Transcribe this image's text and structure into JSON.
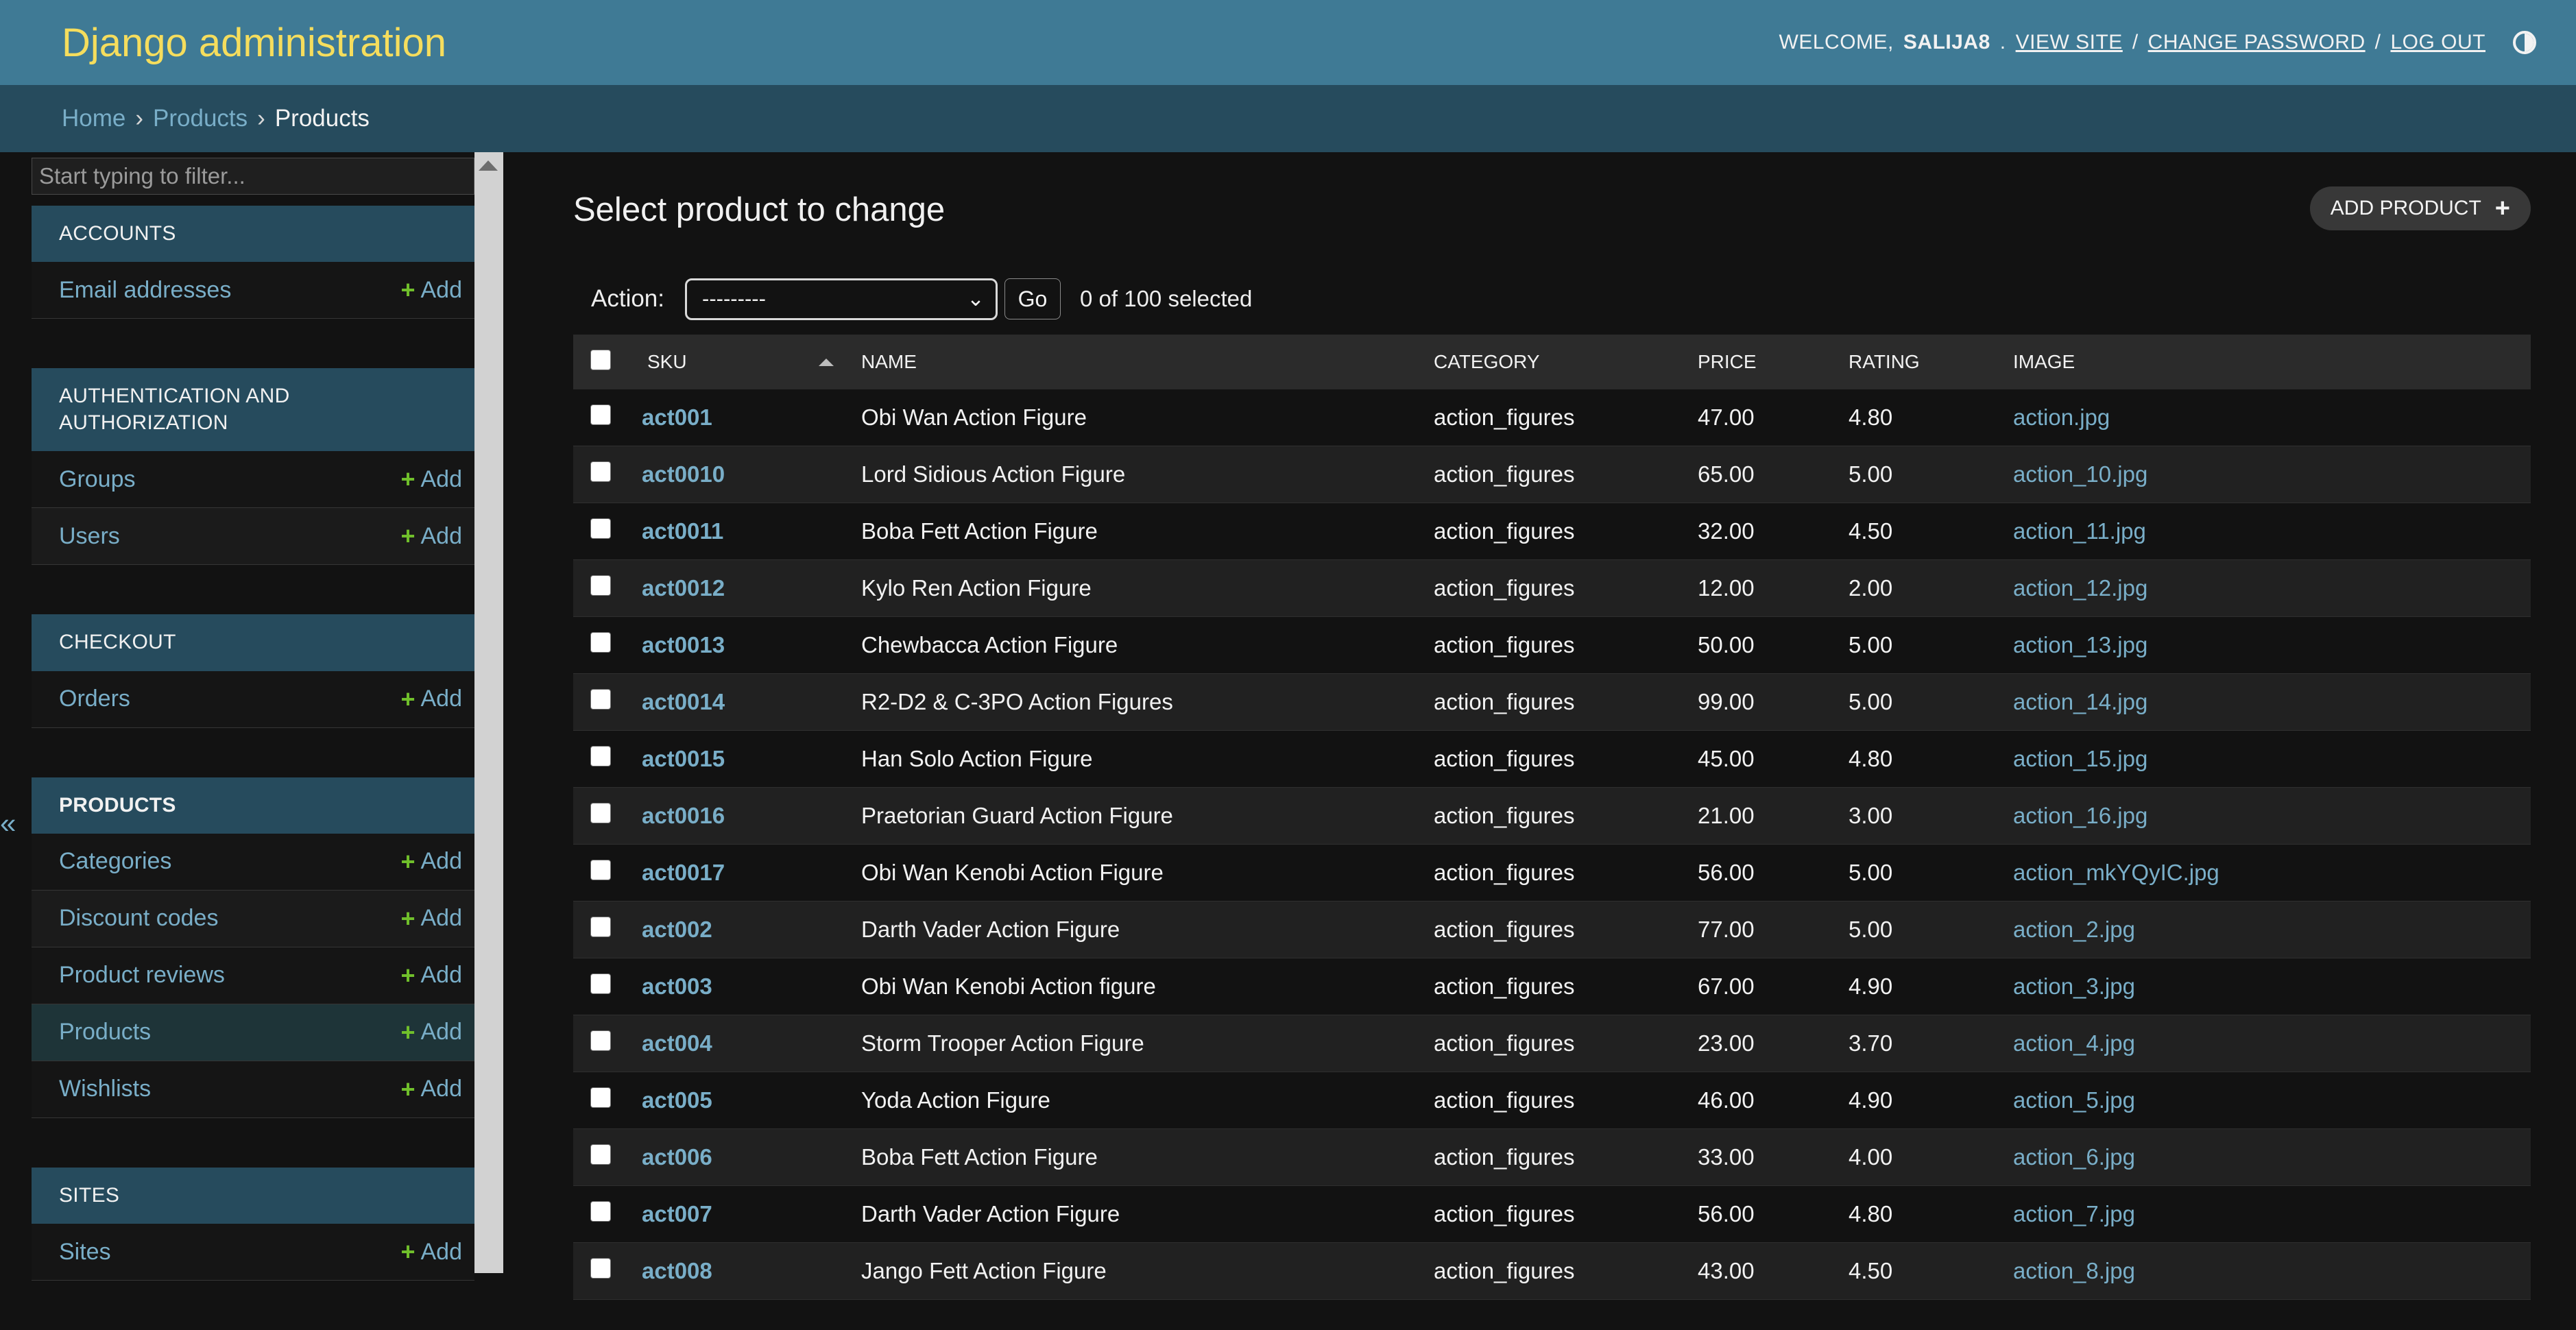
{
  "header": {
    "title": "Django administration",
    "welcome": "WELCOME,",
    "username": "SALIJA8",
    "view_site": "VIEW SITE",
    "change_password": "CHANGE PASSWORD",
    "log_out": "LOG OUT",
    "slash": "/",
    "theme_icon": "theme-toggle-icon"
  },
  "breadcrumbs": [
    "Home",
    "Products",
    "Products"
  ],
  "sidebar": {
    "filter_placeholder": "Start typing to filter...",
    "collapse_icon": "«",
    "modules": [
      {
        "title": "ACCOUNTS",
        "items": [
          {
            "label": "Email addresses",
            "add": "Add",
            "active": false
          }
        ]
      },
      {
        "title": "AUTHENTICATION AND AUTHORIZATION",
        "items": [
          {
            "label": "Groups",
            "add": "Add",
            "active": false
          },
          {
            "label": "Users",
            "add": "Add",
            "active": false
          }
        ]
      },
      {
        "title": "CHECKOUT",
        "items": [
          {
            "label": "Orders",
            "add": "Add",
            "active": false
          }
        ]
      },
      {
        "title": "PRODUCTS",
        "items": [
          {
            "label": "Categories",
            "add": "Add",
            "active": false
          },
          {
            "label": "Discount codes",
            "add": "Add",
            "active": false
          },
          {
            "label": "Product reviews",
            "add": "Add",
            "active": false
          },
          {
            "label": "Products",
            "add": "Add",
            "active": true
          },
          {
            "label": "Wishlists",
            "add": "Add",
            "active": false
          }
        ]
      },
      {
        "title": "SITES",
        "items": [
          {
            "label": "Sites",
            "add": "Add",
            "active": false
          }
        ]
      }
    ]
  },
  "content": {
    "page_title": "Select product to change",
    "add_button": "ADD PRODUCT",
    "action_label": "Action:",
    "action_value": "---------",
    "go": "Go",
    "selected": "0 of 100 selected"
  },
  "table": {
    "headers": [
      "SKU",
      "NAME",
      "CATEGORY",
      "PRICE",
      "RATING",
      "IMAGE"
    ],
    "rows": [
      [
        "act001",
        "Obi Wan Action Figure",
        "action_figures",
        "47.00",
        "4.80",
        "action.jpg"
      ],
      [
        "act0010",
        "Lord Sidious Action Figure",
        "action_figures",
        "65.00",
        "5.00",
        "action_10.jpg"
      ],
      [
        "act0011",
        "Boba Fett Action Figure",
        "action_figures",
        "32.00",
        "4.50",
        "action_11.jpg"
      ],
      [
        "act0012",
        "Kylo Ren Action Figure",
        "action_figures",
        "12.00",
        "2.00",
        "action_12.jpg"
      ],
      [
        "act0013",
        "Chewbacca Action Figure",
        "action_figures",
        "50.00",
        "5.00",
        "action_13.jpg"
      ],
      [
        "act0014",
        "R2-D2 & C-3PO Action Figures",
        "action_figures",
        "99.00",
        "5.00",
        "action_14.jpg"
      ],
      [
        "act0015",
        "Han Solo Action Figure",
        "action_figures",
        "45.00",
        "4.80",
        "action_15.jpg"
      ],
      [
        "act0016",
        "Praetorian Guard Action Figure",
        "action_figures",
        "21.00",
        "3.00",
        "action_16.jpg"
      ],
      [
        "act0017",
        "Obi Wan Kenobi Action Figure",
        "action_figures",
        "56.00",
        "5.00",
        "action_mkYQyIC.jpg"
      ],
      [
        "act002",
        "Darth Vader Action Figure",
        "action_figures",
        "77.00",
        "5.00",
        "action_2.jpg"
      ],
      [
        "act003",
        "Obi Wan Kenobi Action figure",
        "action_figures",
        "67.00",
        "4.90",
        "action_3.jpg"
      ],
      [
        "act004",
        "Storm Trooper Action Figure",
        "action_figures",
        "23.00",
        "3.70",
        "action_4.jpg"
      ],
      [
        "act005",
        "Yoda Action Figure",
        "action_figures",
        "46.00",
        "4.90",
        "action_5.jpg"
      ],
      [
        "act006",
        "Boba Fett Action Figure",
        "action_figures",
        "33.00",
        "4.00",
        "action_6.jpg"
      ],
      [
        "act007",
        "Darth Vader Action Figure",
        "action_figures",
        "56.00",
        "4.80",
        "action_7.jpg"
      ],
      [
        "act008",
        "Jango Fett Action Figure",
        "action_figures",
        "43.00",
        "4.50",
        "action_8.jpg"
      ]
    ]
  }
}
